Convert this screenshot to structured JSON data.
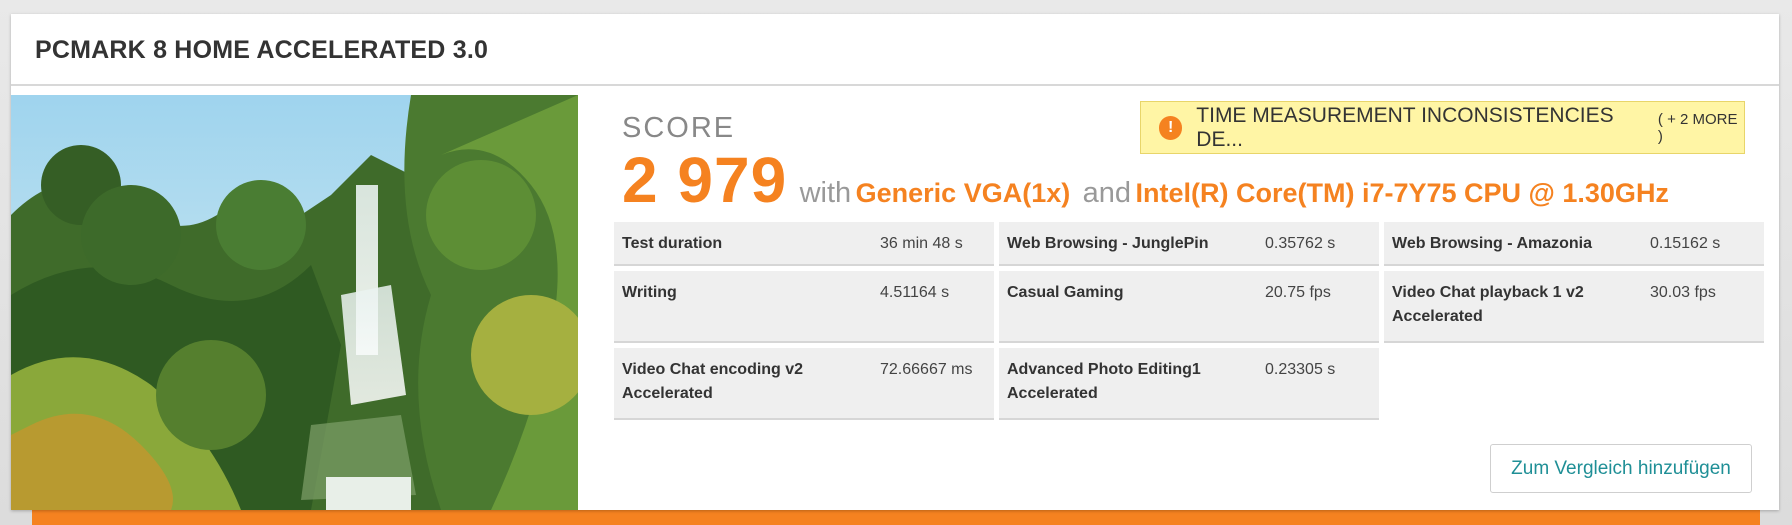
{
  "title": "PCMARK 8 HOME ACCELERATED 3.0",
  "score": {
    "label": "SCORE",
    "value": "2 979",
    "with": "with",
    "gpu": "Generic VGA(1x)",
    "and": "and",
    "cpu": "Intel(R) Core(TM) i7-7Y75 CPU @ 1.30GHz"
  },
  "warning": {
    "icon": "exclamation-circle-icon",
    "text": "TIME MEASUREMENT INCONSISTENCIES DE...",
    "more": "( + 2 MORE )"
  },
  "results": [
    {
      "label": "Test duration",
      "value": "36 min 48 s"
    },
    {
      "label": "Web Browsing - JunglePin",
      "value": "0.35762 s"
    },
    {
      "label": "Web Browsing - Amazonia",
      "value": "0.15162 s"
    },
    {
      "label": "Writing",
      "value": "4.51164 s"
    },
    {
      "label": "Casual Gaming",
      "value": "20.75 fps"
    },
    {
      "label": "Video Chat playback 1 v2 Accelerated",
      "value": "30.03 fps"
    },
    {
      "label": "Video Chat encoding v2 Accelerated",
      "value": "72.66667 ms"
    },
    {
      "label": "Advanced Photo Editing1 Accelerated",
      "value": "0.23305 s"
    }
  ],
  "compare_button": "Zum Vergleich hinzufügen",
  "colors": {
    "accent": "#f58220",
    "link": "#1f8f96",
    "warning_bg": "#fff5a5"
  }
}
